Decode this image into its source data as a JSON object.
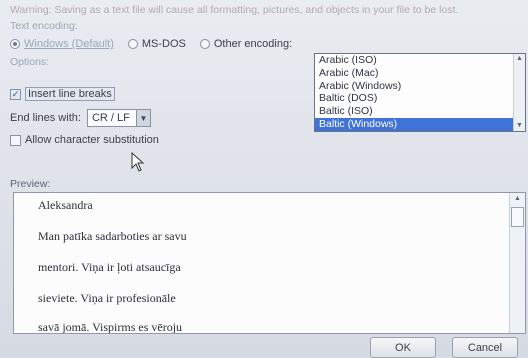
{
  "warning": "Warning: Saving as a text file will cause all formatting, pictures, and objects in your file to be lost.",
  "text_encoding": {
    "label": "Text encoding:",
    "options": [
      {
        "label": "Windows (Default)",
        "selected": true
      },
      {
        "label": "MS-DOS",
        "selected": false
      },
      {
        "label": "Other encoding:",
        "selected": false
      }
    ],
    "encoding_list": {
      "items": [
        "Arabic (ISO)",
        "Arabic (Mac)",
        "Arabic (Windows)",
        "Baltic (DOS)",
        "Baltic (ISO)",
        "Baltic (Windows)"
      ],
      "selected": "Baltic (Windows)"
    }
  },
  "options": {
    "label": "Options:",
    "insert_line_breaks": {
      "label": "Insert line breaks",
      "checked": true
    },
    "end_lines": {
      "label": "End lines with:",
      "value": "CR / LF"
    },
    "allow_substitution": {
      "label": "Allow character substitution",
      "checked": false
    }
  },
  "preview": {
    "label": "Preview:",
    "lines": [
      "Aleksandra",
      "Man patīka sadarboties ar savu",
      "mentori. Viņa ir ļoti atsaucīga",
      "sieviete. Viņa ir profesionāle",
      "savā jomā. Vispirms es vēroju"
    ]
  },
  "buttons": {
    "ok": "OK",
    "cancel": "Cancel"
  },
  "icons": {
    "scroll_up": "chevron-up-icon",
    "scroll_down": "chevron-down-icon",
    "dropdown": "chevron-down-icon",
    "cursor": "mouse-pointer-icon"
  }
}
